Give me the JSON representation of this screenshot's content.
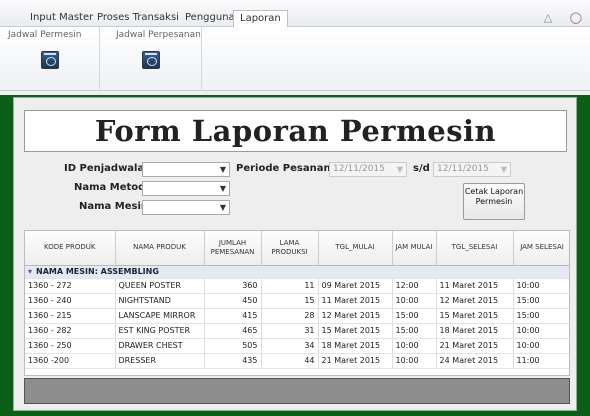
{
  "menu": {
    "tabs": [
      {
        "label": "Input Master"
      },
      {
        "label": "Proses Transaksi"
      },
      {
        "label": "Pengguna"
      },
      {
        "label": "Laporan"
      }
    ],
    "active_tab": "Laporan"
  },
  "ribbon": {
    "groups": [
      {
        "label": "Jadwal Permesin",
        "icon": "report-icon"
      },
      {
        "label": "Jadwal Perpesanan",
        "icon": "report-icon"
      }
    ]
  },
  "form": {
    "title": "Form Laporan Permesin",
    "fields": {
      "id_label": "ID Penjadwalan",
      "metode_label": "Nama Metode",
      "mesin_label": "Nama Mesin",
      "periode_label": "Periode Pesanan",
      "periode_from": "12/11/2015",
      "sd_label": "s/d",
      "periode_to": "12/11/2015"
    },
    "print_button": "Cetak Laporan Permesin"
  },
  "grid": {
    "columns": [
      "KODE PRODUK",
      "NAMA PRODUK",
      "JUMLAH PEMESANAN",
      "LAMA PRODUKSI",
      "TGL_MULAI",
      "JAM MULAI",
      "TGL_SELESAI",
      "JAM SELESAI"
    ],
    "group_label": "NAMA MESIN: ASSEMBLING",
    "rows": [
      [
        "1360 - 272",
        "QUEEN POSTER",
        "360",
        "11",
        "09 Maret 2015",
        "12:00",
        "11 Maret 2015",
        "10:00"
      ],
      [
        "1360 - 240",
        "NIGHTSTAND",
        "450",
        "15",
        "11 Maret 2015",
        "10:00",
        "12 Maret 2015",
        "15:00"
      ],
      [
        "1360 - 215",
        "LANSCAPE MIRROR",
        "415",
        "28",
        "12 Maret 2015",
        "15:00",
        "15 Maret 2015",
        "15:00"
      ],
      [
        "1360 - 282",
        "EST KING POSTER",
        "465",
        "31",
        "15 Maret 2015",
        "15:00",
        "18 Maret 2015",
        "10:00"
      ],
      [
        "1360 - 250",
        "DRAWER CHEST",
        "505",
        "34",
        "18 Maret 2015",
        "10:00",
        "21 Maret 2015",
        "10:00"
      ],
      [
        "1360 -200",
        "DRESSER",
        "435",
        "44",
        "21 Maret 2015",
        "10:00",
        "24 Maret 2015",
        "11:00"
      ]
    ]
  },
  "colors": {
    "frame_green": "#0d5e16",
    "group_row": "#e4e9f3"
  }
}
